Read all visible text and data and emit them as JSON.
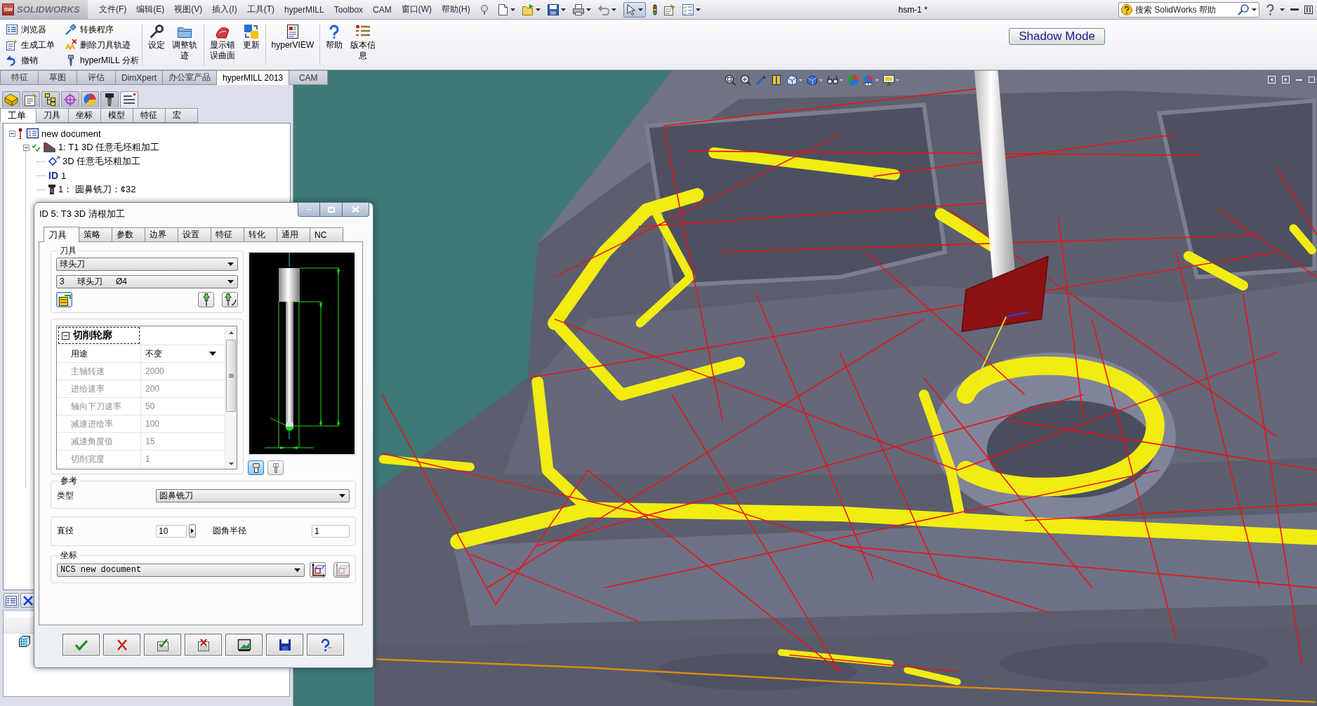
{
  "title_bar": {
    "logo_mark": "SW",
    "app_name": "SOLIDWORKS",
    "menu": [
      "文件(F)",
      "编辑(E)",
      "视图(V)",
      "插入(I)",
      "工具(T)",
      "hyperMILL",
      "Toolbox",
      "CAM",
      "窗口(W)",
      "帮助(H)"
    ],
    "document_title": "hsm-1 *",
    "search": {
      "placeholder": "搜索 SolidWorks 帮助"
    }
  },
  "ribbon": {
    "small_buttons": [
      {
        "label": "浏览器",
        "kind": "browser"
      },
      {
        "label": "生成工单",
        "kind": "job"
      },
      {
        "label": "撤销",
        "kind": "undo"
      },
      {
        "label": "转换程序",
        "kind": "convert"
      },
      {
        "label": "删除刀具轨迹",
        "kind": "delete"
      },
      {
        "label": "hyperMILL 分析",
        "kind": "analysis"
      }
    ],
    "large_button_groups": [
      [
        {
          "label": "设定",
          "kind": "settings"
        },
        {
          "label": "调整轨迹",
          "kind": "adjust"
        }
      ],
      [
        {
          "label": "显示错误曲面",
          "kind": "surface"
        },
        {
          "label": "更新",
          "kind": "update"
        }
      ],
      [
        {
          "label": "hyperVIEW",
          "kind": "view"
        }
      ],
      [
        {
          "label": "帮助",
          "kind": "help"
        },
        {
          "label": "版本信息",
          "kind": "info"
        }
      ]
    ],
    "shadow_mode_button": "Shadow Mode"
  },
  "command_tabs": [
    {
      "label": "特征",
      "selected": false
    },
    {
      "label": "草图",
      "selected": false
    },
    {
      "label": "评估",
      "selected": false
    },
    {
      "label": "DimXpert",
      "selected": false
    },
    {
      "label": "办公室产品",
      "selected": false
    },
    {
      "label": "hyperMILL 2013",
      "selected": true
    },
    {
      "label": "CAM",
      "selected": false
    }
  ],
  "left_panel": {
    "icon_tabs": [
      {
        "kind": "part",
        "selected": false
      },
      {
        "kind": "properties",
        "selected": false
      },
      {
        "kind": "tree",
        "selected": false
      },
      {
        "kind": "origin",
        "selected": false
      },
      {
        "kind": "appearance",
        "selected": false
      },
      {
        "kind": "tool",
        "selected": false
      },
      {
        "kind": "list",
        "selected": true
      }
    ],
    "job_tabs": [
      {
        "label": "工单",
        "selected": true
      },
      {
        "label": "刀具",
        "selected": false
      },
      {
        "label": "坐标",
        "selected": false
      },
      {
        "label": "模型",
        "selected": false
      },
      {
        "label": "特征",
        "selected": false
      },
      {
        "label": "宏",
        "selected": false
      }
    ],
    "tree": [
      {
        "kind": "document",
        "label": "new document",
        "expanded": true,
        "children": [
          {
            "kind": "job",
            "label": "1: T1 3D 任意毛坯粗加工",
            "calculated": true,
            "expanded": true,
            "children": [
              {
                "kind": "strategy",
                "label": "3D 任意毛坯粗加工"
              },
              {
                "kind": "id",
                "badge": "ID",
                "label": "1"
              },
              {
                "kind": "tool",
                "label": "1： 圆鼻铣刀：¢32"
              }
            ]
          }
        ]
      }
    ]
  },
  "dialog": {
    "title": "ID 5: T3 3D 清根加工",
    "tabs": [
      {
        "label": "刀具",
        "selected": true
      },
      {
        "label": "策略",
        "selected": false
      },
      {
        "label": "参数",
        "selected": false
      },
      {
        "label": "边界",
        "selected": false
      },
      {
        "label": "设置",
        "selected": false
      },
      {
        "label": "特征",
        "selected": false
      },
      {
        "label": "转化",
        "selected": false
      },
      {
        "label": "通用",
        "selected": false
      },
      {
        "label": "NC",
        "selected": false
      }
    ],
    "tool_group": {
      "title": "刀具",
      "tool_type": "球头刀",
      "tool": "3  球头刀  Ø4"
    },
    "property_grid": {
      "section": "切削轮廓",
      "expanded": true,
      "rows": [
        {
          "name": "用途",
          "value": "不变",
          "kind": "dropdown",
          "disabled": false
        },
        {
          "name": "主轴转速",
          "value": "2000",
          "kind": "text",
          "disabled": true
        },
        {
          "name": "进给速率",
          "value": "200",
          "kind": "text",
          "disabled": true
        },
        {
          "name": "轴向下刀速率",
          "value": "50",
          "kind": "text",
          "disabled": true
        },
        {
          "name": "减速进给率",
          "value": "100",
          "kind": "text",
          "disabled": true
        },
        {
          "name": "减速角度值",
          "value": "15",
          "kind": "text",
          "disabled": true
        },
        {
          "name": "切削宽度",
          "value": "1",
          "kind": "text",
          "disabled": true
        }
      ]
    },
    "preview_buttons": [
      {
        "kind": "holder",
        "selected": true
      },
      {
        "kind": "outline",
        "selected": false
      }
    ],
    "reference_group": {
      "title": "参考",
      "type_label": "类型",
      "type_value": "圆鼻铣刀"
    },
    "dimensions_group": {
      "diameter_label": "直径",
      "diameter_value": "10",
      "corner_radius_label": "圆角半径",
      "corner_radius_value": "1"
    },
    "coordinates_group": {
      "title": "坐标",
      "value": "NCS new document"
    },
    "buttons": [
      {
        "kind": "ok"
      },
      {
        "kind": "cancel"
      },
      {
        "kind": "apply"
      },
      {
        "kind": "discard"
      },
      {
        "kind": "preview"
      },
      {
        "kind": "save"
      },
      {
        "kind": "help"
      }
    ]
  }
}
